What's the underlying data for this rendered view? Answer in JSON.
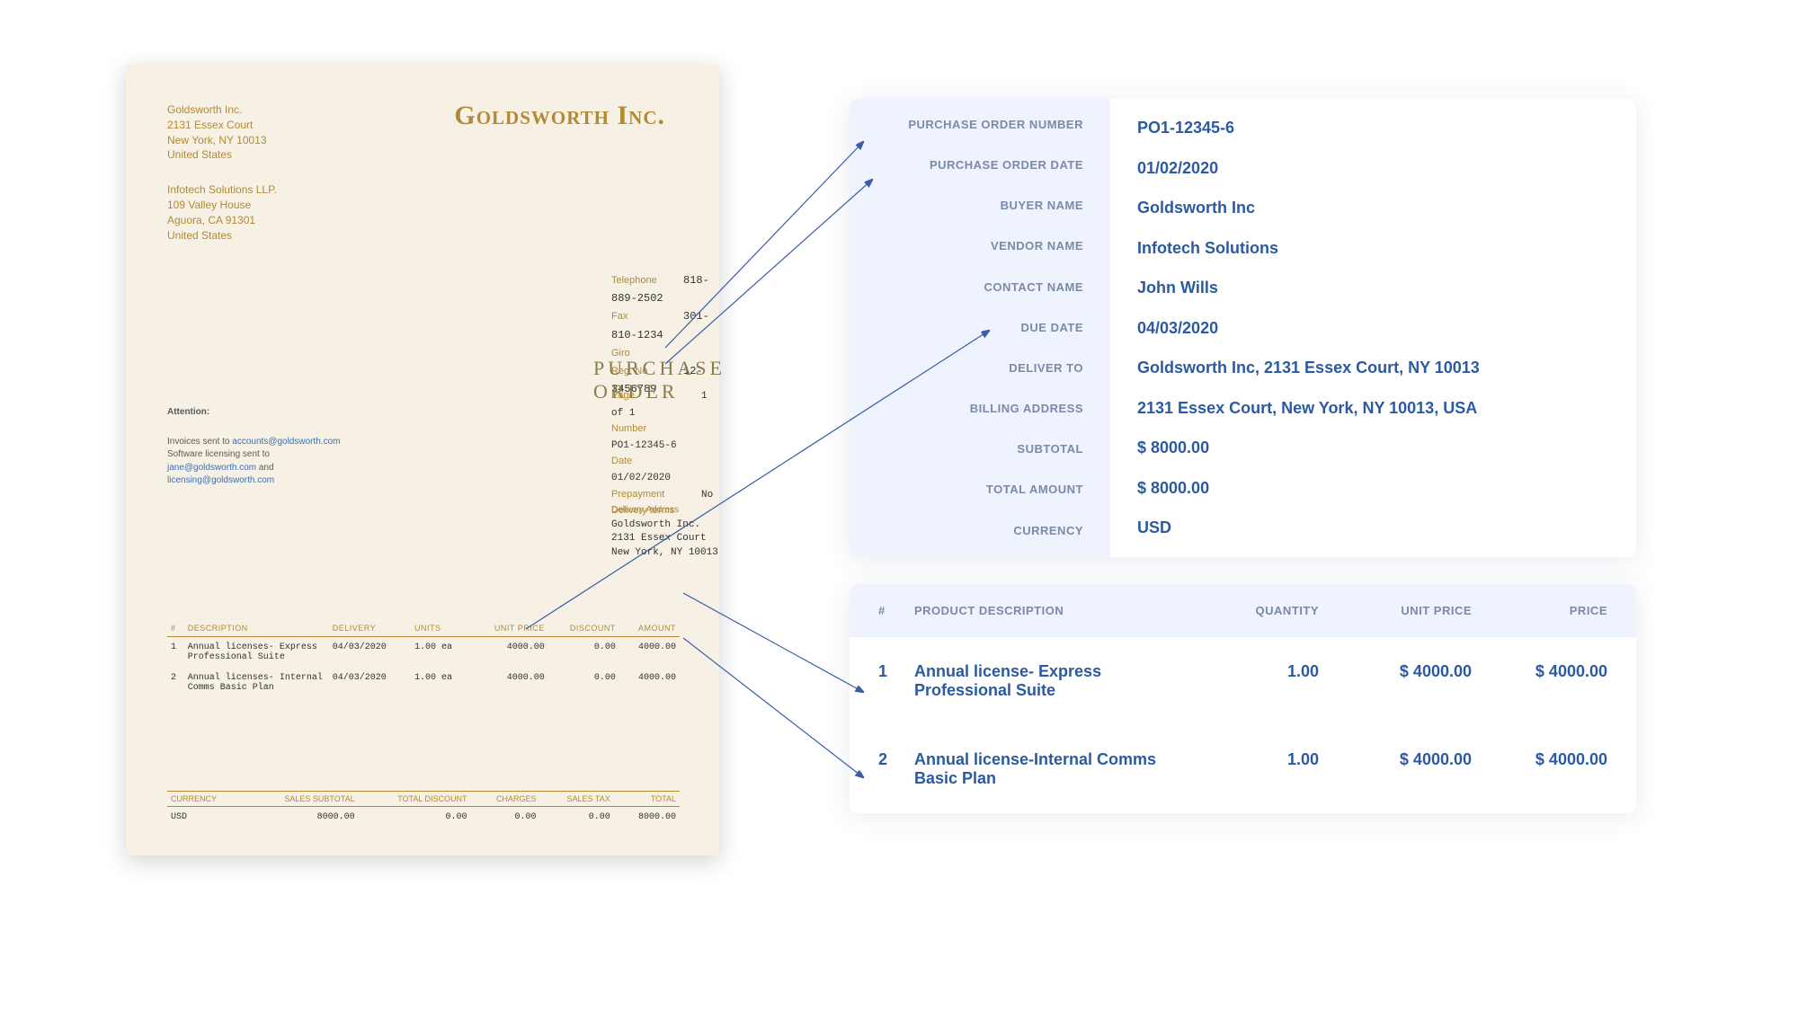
{
  "doc": {
    "company_title": "Goldsworth Inc.",
    "buyer_addr": {
      "name": "Goldsworth Inc.",
      "line1": "2131 Essex Court",
      "line2": "New York, NY 10013",
      "country": "United States"
    },
    "vendor_addr": {
      "name": "Infotech Solutions LLP.",
      "line1": "109 Valley House",
      "line2": "Aguora, CA 91301",
      "country": "United States"
    },
    "contact": {
      "telephone_lbl": "Telephone",
      "telephone": "818-889-2502",
      "fax_lbl": "Fax",
      "fax": "301-810-1234",
      "giro_lbl": "Giro",
      "giro": "",
      "regno_lbl": "Reg. No",
      "regno": "12-3456789"
    },
    "po_title": "PURCHASE ORDER",
    "po_meta": {
      "page_lbl": "Page",
      "page": "1 of 1",
      "number_lbl": "Number",
      "number": "PO1-12345-6",
      "date_lbl": "Date",
      "date": "01/02/2020",
      "prepay_lbl": "Prepayment",
      "prepay": "No",
      "terms_lbl": "Delivery terms",
      "terms": ""
    },
    "attention": {
      "hdr": "Attention:",
      "line1a": "Invoices sent to ",
      "email1": "accounts@goldsworth.com",
      "line2": "Software licensing sent to",
      "email2a": "jane@goldsworth.com",
      "and": " and",
      "email2b": "licensing@goldsworth.com"
    },
    "delivery": {
      "lbl": "Delivery Address",
      "name": "Goldsworth Inc.",
      "line1": "2131 Essex Court",
      "line2": "New York, NY 10013"
    },
    "items_hdr": {
      "n": "#",
      "desc": "DESCRIPTION",
      "del": "DELIVERY",
      "units": "UNITS",
      "up": "UNIT PRICE",
      "disc": "DISCOUNT",
      "amt": "AMOUNT"
    },
    "items": [
      {
        "n": "1",
        "desc": "Annual licenses- Express Professional Suite",
        "del": "04/03/2020",
        "units": "1.00 ea",
        "up": "4000.00",
        "disc": "0.00",
        "amt": "4000.00"
      },
      {
        "n": "2",
        "desc": "Annual licenses- Internal Comms Basic Plan",
        "del": "04/03/2020",
        "units": "1.00 ea",
        "up": "4000.00",
        "disc": "0.00",
        "amt": "4000.00"
      }
    ],
    "totals_hdr": {
      "cur": "CURRENCY",
      "sub": "SALES SUBTOTAL",
      "disc": "TOTAL DISCOUNT",
      "chg": "CHARGES",
      "tax": "SALES TAX",
      "tot": "TOTAL"
    },
    "totals": {
      "cur": "USD",
      "sub": "8000.00",
      "disc": "0.00",
      "chg": "0.00",
      "tax": "0.00",
      "tot": "8000.00"
    }
  },
  "summary": {
    "labels": {
      "po_number": "PURCHASE ORDER NUMBER",
      "po_date": "PURCHASE ORDER DATE",
      "buyer": "BUYER NAME",
      "vendor": "VENDOR NAME",
      "contact": "CONTACT NAME",
      "due": "DUE DATE",
      "deliver": "DELIVER TO",
      "billing": "BILLING ADDRESS",
      "subtotal": "SUBTOTAL",
      "total": "TOTAL AMOUNT",
      "currency": "CURRENCY"
    },
    "values": {
      "po_number": "PO1-12345-6",
      "po_date": "01/02/2020",
      "buyer": "Goldsworth Inc",
      "vendor": "Infotech Solutions",
      "contact": "John Wills",
      "due": "04/03/2020",
      "deliver": "Goldsworth Inc, 2131 Essex Court, NY 10013",
      "billing": "2131 Essex Court, New York, NY 10013, USA",
      "subtotal": "$ 8000.00",
      "total": "$ 8000.00",
      "currency": "USD"
    }
  },
  "lines": {
    "hdr": {
      "n": "#",
      "desc": "PRODUCT DESCRIPTION",
      "qty": "QUANTITY",
      "up": "UNIT PRICE",
      "price": "PRICE"
    },
    "rows": [
      {
        "n": "1",
        "desc": "Annual license- Express Professional Suite",
        "qty": "1.00",
        "up": "$ 4000.00",
        "price": "$ 4000.00"
      },
      {
        "n": "2",
        "desc": "Annual license-Internal Comms Basic Plan",
        "qty": "1.00",
        "up": "$ 4000.00",
        "price": "$ 4000.00"
      }
    ]
  }
}
